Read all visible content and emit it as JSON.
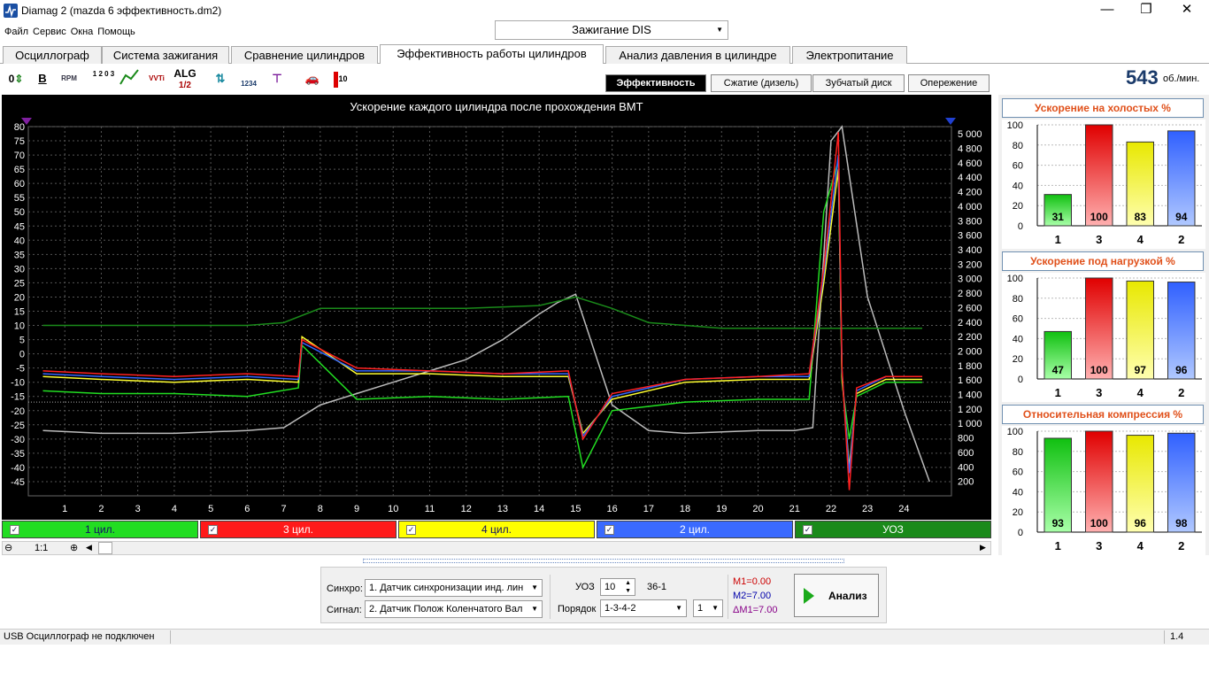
{
  "window": {
    "title": "Diamag 2 (mazda 6 эффективность.dm2)",
    "minimize": "—",
    "maximize": "❐",
    "close": "✕"
  },
  "menu": [
    "Файл",
    "Сервис",
    "Окна",
    "Помощь"
  ],
  "ignition_mode": "Зажигание DIS",
  "tabs": [
    "Осциллограф",
    "Система зажигания",
    "Сравнение цилиндров",
    "Эффективность работы цилиндров",
    "Анализ давления в цилиндре",
    "Электропитание"
  ],
  "active_tab": 3,
  "toolbar": {
    "zero": "0",
    "bold": "B",
    "rpm": "RPM",
    "io": "1 2 0 3",
    "alg": "ALG",
    "alg_sub": "1/2",
    "order": "1234",
    "level": "10",
    "vvti": "VVTi"
  },
  "subtabs": [
    "Эффективность",
    "Сжатие (дизель)",
    "Зубчатый диск",
    "Опережение"
  ],
  "active_subtab": 0,
  "rpm": {
    "value": "543",
    "unit": "об./мин."
  },
  "chart_data": {
    "type": "line",
    "title": "Ускорение каждого цилиндра после прохождения ВМТ",
    "x_ticks": [
      "1",
      "2",
      "3",
      "4",
      "5",
      "6",
      "7",
      "8",
      "9",
      "10",
      "11",
      "12",
      "13",
      "14",
      "15",
      "16",
      "17",
      "18",
      "19",
      "20",
      "21",
      "22",
      "23",
      "24"
    ],
    "y_left_ticks": [
      "80",
      "75",
      "70",
      "65",
      "60",
      "55",
      "50",
      "45",
      "40",
      "35",
      "30",
      "25",
      "20",
      "15",
      "10",
      "5",
      "0",
      "-5",
      "-10",
      "-15",
      "-20",
      "-25",
      "-30",
      "-35",
      "-40",
      "-45"
    ],
    "y_left_range": [
      -50,
      80
    ],
    "y_right_ticks": [
      "5 000",
      "4 800",
      "4 600",
      "4 400",
      "4 200",
      "4 000",
      "3 800",
      "3 600",
      "3 400",
      "3 200",
      "3 000",
      "2 800",
      "2 600",
      "2 400",
      "2 200",
      "2 000",
      "1 800",
      "1 600",
      "1 400",
      "1 200",
      "1 000",
      "800",
      "600",
      "400",
      "200"
    ],
    "y_right_range": [
      0,
      5100
    ],
    "grid": true,
    "series": [
      {
        "name": "1 цил.",
        "color": "#22dd22",
        "x": [
          0.4,
          2,
          4,
          6,
          7.4,
          7.5,
          9,
          11,
          13,
          14.8,
          15.2,
          16,
          18,
          20,
          21.4,
          21.8,
          22.2,
          22.3,
          22.5,
          22.7,
          23.5,
          24.5
        ],
        "y": [
          -13,
          -14,
          -14,
          -15,
          -12,
          3,
          -16,
          -15,
          -16,
          -15,
          -40,
          -20,
          -17,
          -16,
          -16,
          50,
          68,
          -10,
          -30,
          -15,
          -10,
          -10
        ]
      },
      {
        "name": "3 цил.",
        "color": "#ff2020",
        "x": [
          0.4,
          2,
          4,
          6,
          7.4,
          7.5,
          9,
          11,
          13,
          14.8,
          15.2,
          16,
          18,
          20,
          21.4,
          21.8,
          22.2,
          22.3,
          22.5,
          22.7,
          23.5,
          24.5
        ],
        "y": [
          -6,
          -7,
          -8,
          -7,
          -8,
          5,
          -5,
          -6,
          -7,
          -6,
          -30,
          -14,
          -9,
          -8,
          -7,
          30,
          78,
          -5,
          -48,
          -12,
          -8,
          -8
        ]
      },
      {
        "name": "4 цил.",
        "color": "#ffff30",
        "x": [
          0.4,
          2,
          4,
          6,
          7.4,
          7.5,
          9,
          11,
          13,
          14.8,
          15.2,
          16,
          18,
          20,
          21.4,
          21.8,
          22.2,
          22.3,
          22.5,
          22.7,
          23.5,
          24.5
        ],
        "y": [
          -8,
          -9,
          -10,
          -9,
          -10,
          6,
          -7,
          -7,
          -8,
          -8,
          -28,
          -16,
          -10,
          -9,
          -9,
          25,
          65,
          -8,
          -40,
          -14,
          -9,
          -9
        ]
      },
      {
        "name": "2 цил.",
        "color": "#3366ff",
        "x": [
          0.4,
          2,
          4,
          6,
          7.4,
          7.5,
          9,
          11,
          13,
          14.8,
          15.2,
          16,
          18,
          20,
          21.4,
          21.8,
          22.2,
          22.3,
          22.5,
          22.7,
          23.5,
          24.5
        ],
        "y": [
          -7,
          -8,
          -9,
          -8,
          -9,
          4,
          -6,
          -6,
          -7,
          -7,
          -29,
          -15,
          -9,
          -8,
          -8,
          28,
          70,
          -6,
          -42,
          -13,
          -8,
          -8
        ]
      },
      {
        "name": "УОЗ",
        "color": "#1a8a1a",
        "x": [
          0.4,
          2,
          4,
          6,
          7,
          8,
          10,
          12,
          14,
          15,
          16,
          17,
          18,
          19,
          20,
          21,
          21.5,
          22,
          22.3,
          22.6,
          23,
          24.5
        ],
        "y": [
          10,
          10,
          10,
          10,
          11,
          16,
          16,
          16,
          17,
          20,
          16,
          11,
          10,
          9,
          9,
          9,
          9,
          9,
          9,
          9,
          9,
          9
        ]
      },
      {
        "name": "RPM",
        "color": "#bbbbbb",
        "x": [
          0.4,
          2,
          4,
          6,
          7,
          8,
          9,
          10,
          11,
          12,
          13,
          14,
          14.5,
          15,
          16,
          17,
          18,
          20,
          21,
          21.5,
          22,
          22.3,
          23,
          24,
          24.7
        ],
        "y": [
          -27,
          -28,
          -28,
          -27,
          -26,
          -18,
          -14,
          -10,
          -6,
          -2,
          5,
          14,
          18,
          21,
          -18,
          -27,
          -28,
          -27,
          -27,
          -26,
          75,
          80,
          20,
          -20,
          -45
        ]
      }
    ]
  },
  "legend": [
    "1 цил.",
    "3 цил.",
    "4 цил.",
    "2 цил.",
    "УОЗ"
  ],
  "legend_colors": [
    "#22dd22",
    "#ff1a1a",
    "#ffff00",
    "#3a6aff",
    "#1a8a1a"
  ],
  "zoom": "1:1",
  "panels": [
    {
      "title": "Ускорение на холостых %",
      "categories": [
        "1",
        "3",
        "4",
        "2"
      ],
      "values": [
        31,
        100,
        83,
        94
      ]
    },
    {
      "title": "Ускорение под нагрузкой %",
      "categories": [
        "1",
        "3",
        "4",
        "2"
      ],
      "values": [
        47,
        100,
        97,
        96
      ]
    },
    {
      "title": "Относительная компрессия %",
      "categories": [
        "1",
        "3",
        "4",
        "2"
      ],
      "values": [
        93,
        100,
        96,
        98
      ]
    }
  ],
  "panel_y_ticks": [
    "100",
    "80",
    "60",
    "40",
    "20",
    "0"
  ],
  "bottom": {
    "sync_label": "Синхро:",
    "sync_value": "1.  Датчик синхронизации инд. лин",
    "signal_label": "Сигнал:",
    "signal_value": "2.  Датчик Полож Коленчатого Вал",
    "uoz_label": "УОЗ",
    "uoz_value": "10",
    "teeth": "36-1",
    "order_label": "Порядок",
    "order_value": "1-3-4-2",
    "order_idx": "1",
    "m1": "M1=0.00",
    "m2": "M2=7.00",
    "dm1": "ΔM1=7.00",
    "analyze": "Анализ"
  },
  "status": {
    "left": "USB Осциллограф не подключен",
    "right": "1.4"
  }
}
